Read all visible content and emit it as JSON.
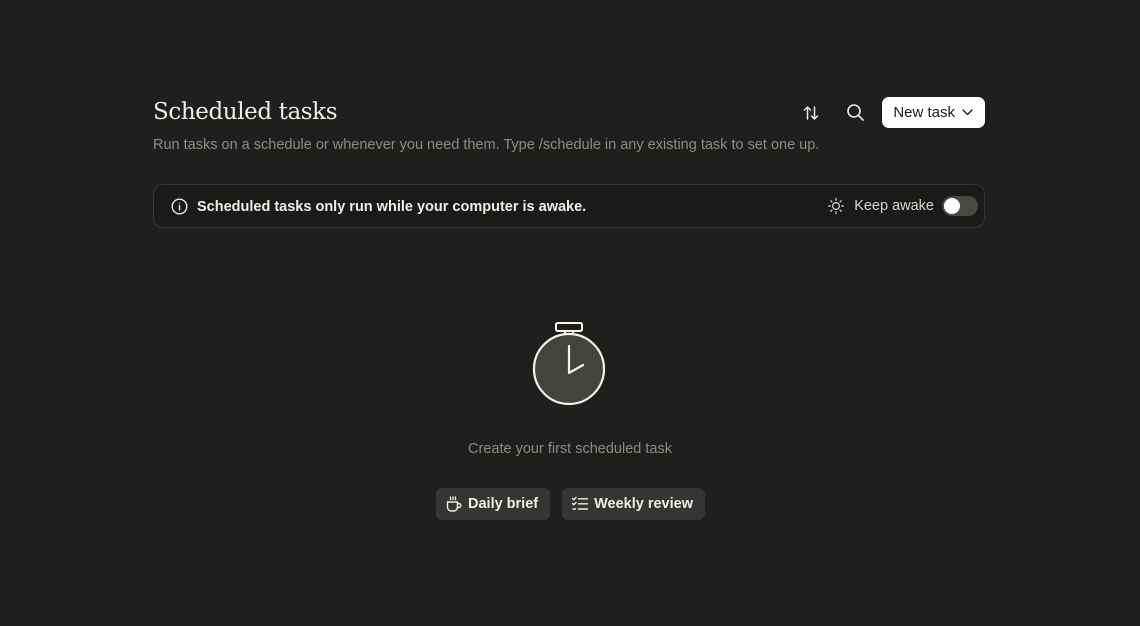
{
  "header": {
    "title": "Scheduled tasks",
    "subtitle": "Run tasks on a schedule or whenever you need them. Type /schedule in any existing task to set one up.",
    "sort_icon": "sort-arrows-icon",
    "search_icon": "search-icon",
    "new_task_label": "New task",
    "new_task_chevron_icon": "chevron-down-icon"
  },
  "banner": {
    "info_icon": "info-icon",
    "message": "Scheduled tasks only run while your computer is awake.",
    "keep_awake_icon": "sun-icon",
    "keep_awake_label": "Keep awake",
    "keep_awake_enabled": false
  },
  "empty_state": {
    "illustration_icon": "stopwatch-icon",
    "message": "Create your first scheduled task",
    "templates": [
      {
        "label": "Daily brief",
        "icon": "coffee-cup-icon"
      },
      {
        "label": "Weekly review",
        "icon": "checklist-icon"
      }
    ]
  },
  "colors": {
    "background": "#201f1e",
    "banner_background": "#1b1a19",
    "chip_background": "#363533",
    "primary_button": "#ffffff",
    "muted_text": "#8e8a84"
  }
}
